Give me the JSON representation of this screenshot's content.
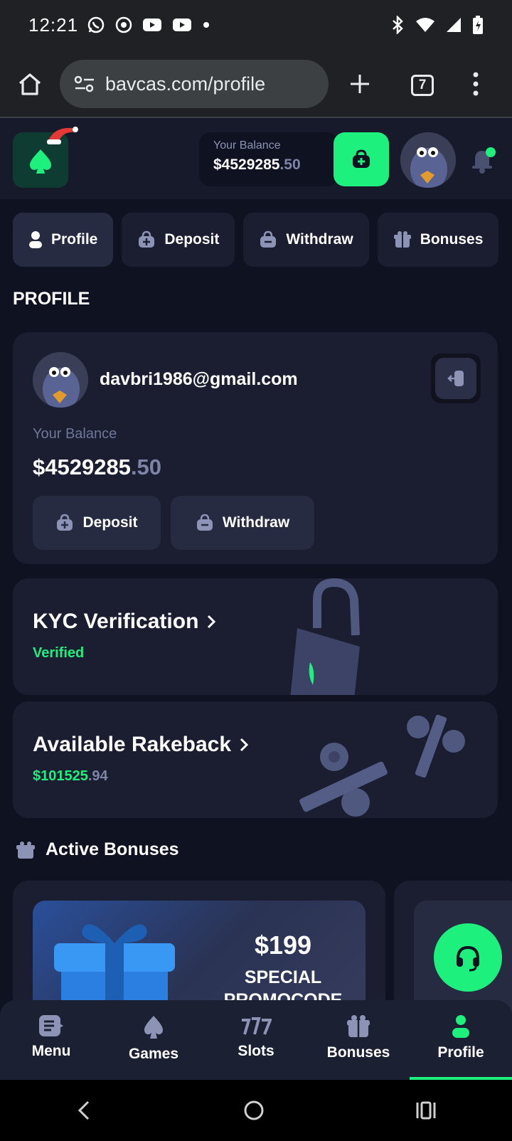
{
  "status_bar": {
    "time": "12:21",
    "icons": [
      "whatsapp-icon",
      "chrome-icon",
      "youtube-icon",
      "youtube-icon",
      "dot-icon"
    ],
    "right_icons": [
      "bluetooth-icon",
      "wifi-icon",
      "signal-icon",
      "battery-icon"
    ]
  },
  "browser": {
    "url": "bavcas.com/profile",
    "tab_count": "7"
  },
  "header": {
    "balance_label": "Your Balance",
    "balance_main": "$4529285",
    "balance_cents": ".50"
  },
  "tabs": [
    {
      "label": "Profile",
      "icon": "user-icon"
    },
    {
      "label": "Deposit",
      "icon": "wallet-plus-icon"
    },
    {
      "label": "Withdraw",
      "icon": "wallet-minus-icon"
    },
    {
      "label": "Bonuses",
      "icon": "gift-icon"
    }
  ],
  "page_title": "PROFILE",
  "profile_card": {
    "email": "davbri1986@gmail.com",
    "balance_label": "Your Balance",
    "balance_main": "$4529285",
    "balance_cents": ".50",
    "deposit_label": "Deposit",
    "withdraw_label": "Withdraw"
  },
  "kyc": {
    "title": "KYC Verification",
    "status": "Verified"
  },
  "rakeback": {
    "title": "Available Rakeback",
    "amount_main": "$101525",
    "amount_cents": ".94"
  },
  "active_bonuses": {
    "title": "Active Bonuses",
    "card": {
      "amount": "$199",
      "text_line1": "SPECIAL",
      "text_line2": "PROMOCODE"
    }
  },
  "bottom_nav": [
    {
      "label": "Menu",
      "icon": "menu-icon"
    },
    {
      "label": "Games",
      "icon": "games-icon"
    },
    {
      "label": "Slots",
      "icon": "slots-icon"
    },
    {
      "label": "Bonuses",
      "icon": "gift-icon"
    },
    {
      "label": "Profile",
      "icon": "user-icon",
      "active": true
    }
  ],
  "colors": {
    "accent": "#1ef07e",
    "background": "#0f1220",
    "card": "#1a1e30"
  }
}
